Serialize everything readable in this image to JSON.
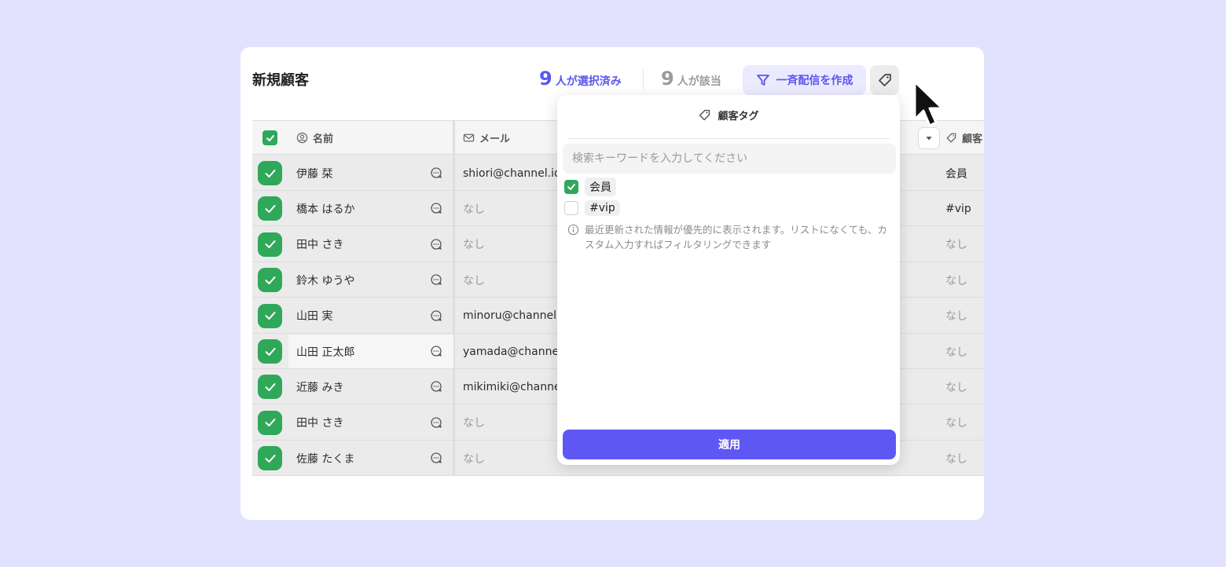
{
  "header": {
    "title": "新規顧客",
    "selected_num": "9",
    "selected_label": "人が選択済み",
    "match_num": "9",
    "match_label": "人が該当",
    "broadcast_label": "一斉配信を作成"
  },
  "table": {
    "columns": {
      "name": "名前",
      "email": "メール",
      "tag": "顧客"
    },
    "rows": [
      {
        "name": "伊藤 栞",
        "email": "shiori@channel.io",
        "tag": "会員"
      },
      {
        "name": "橋本 はるか",
        "email": "なし",
        "tag": "#vip"
      },
      {
        "name": "田中 さき",
        "email": "なし",
        "tag": "なし"
      },
      {
        "name": "鈴木 ゆうや",
        "email": "なし",
        "tag": "なし"
      },
      {
        "name": "山田 実",
        "email": "minoru@channel.io",
        "tag": "なし"
      },
      {
        "name": "山田 正太郎",
        "email": "yamada@channel.io",
        "tag": "なし"
      },
      {
        "name": "近藤 みき",
        "email": "mikimiki@channel.io",
        "tag": "なし"
      },
      {
        "name": "田中 さき",
        "email": "なし",
        "tag": "なし"
      },
      {
        "name": "佐藤 たくま",
        "email": "なし",
        "tag": "なし"
      }
    ]
  },
  "popup": {
    "title": "顧客タグ",
    "search_placeholder": "検索キーワードを入力してください",
    "options": [
      {
        "label": "会員",
        "checked": true
      },
      {
        "label": "#vip",
        "checked": false
      }
    ],
    "info": "最近更新された情報が優先的に表示されます。リストになくても、カスタム入力すればフィルタリングできます",
    "apply_label": "適用"
  },
  "colors": {
    "accent": "#5f57f3",
    "check_green": "#2fa85a",
    "background": "#e3e2fe"
  }
}
